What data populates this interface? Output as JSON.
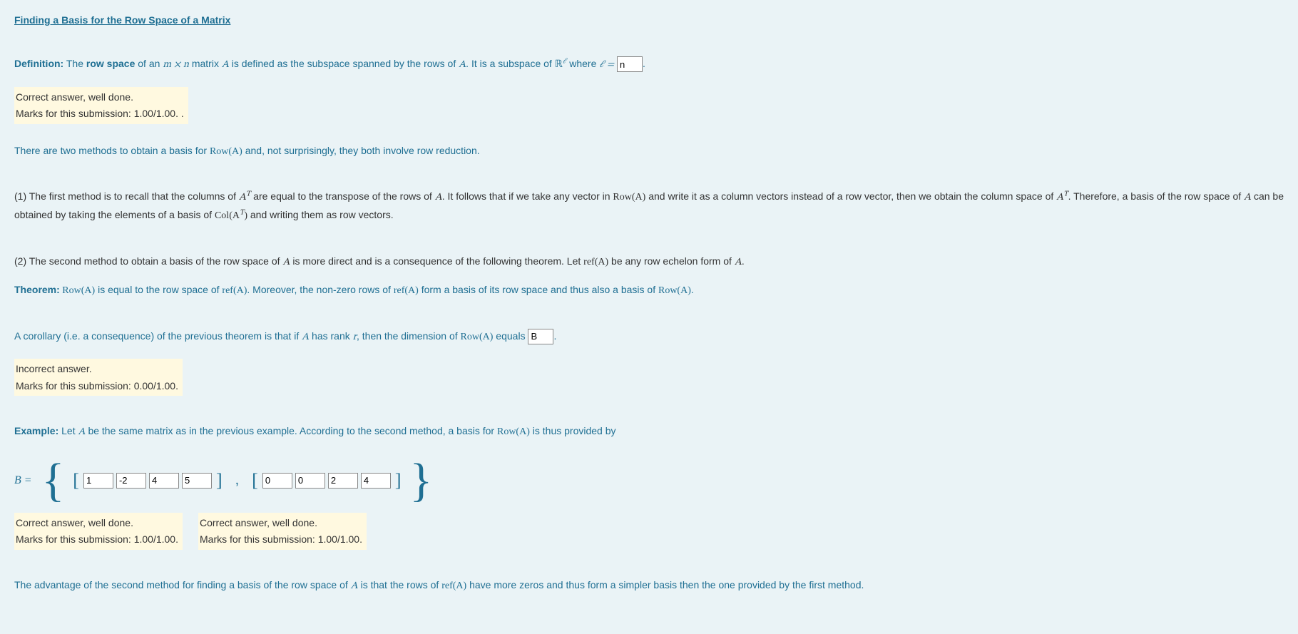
{
  "heading": "Finding a Basis for the Row Space of a Matrix",
  "definition": {
    "label": "Definition:",
    "pre": " The ",
    "term": "row space",
    "mid1": " of an ",
    "mxn": "m × n",
    "mid2": " matrix ",
    "A": "A",
    "mid3": " is defined as the subspace spanned by the rows of ",
    "A2": "A",
    "mid4": ". It is a subspace of ",
    "R": "ℝ",
    "ell": "ℓ",
    "where": " where ",
    "eq": "ℓ =",
    "input_value": "n",
    "period": "."
  },
  "feedback1": {
    "line1": "Correct answer, well done.",
    "line2": "Marks for this submission: 1.00/1.00. ."
  },
  "intro2": {
    "pre": "There are two methods to obtain a basis for ",
    "rowA": "Row(A)",
    "post": " and, not surprisingly, they both involve row reduction."
  },
  "method1": {
    "pre": "(1) The first method is to recall that the columns of ",
    "AT": "A",
    "Tsup": "T",
    "mid1": " are equal to the transpose of the rows of ",
    "A": "A",
    "mid2": ". It follows that if we take any vector in ",
    "rowA": "Row(A)",
    "mid3": " and write it as a column vectors instead of a row vector, then we obtain the column space of ",
    "AT2": "A",
    "Tsup2": "T",
    "mid4": ". Therefore, a basis of the row space of ",
    "A2": "A",
    "mid5": " can be obtained by taking the elements of a basis of ",
    "colAT": "Col(A",
    "Tsup3": "T",
    "colAT_close": ")",
    "post": " and writing them as row vectors."
  },
  "method2": {
    "pre": "(2) The second method to obtain a basis of the row space of ",
    "A": "A",
    "mid1": " is more direct and is  a consequence of the following theorem. Let ",
    "refA": "ref(A)",
    "mid2": " be any row echelon form of ",
    "A2": "A",
    "post": "."
  },
  "theorem": {
    "label": "Theorem:",
    "rowA": " Row(A)",
    "mid1": " is equal to the row space of ",
    "refA": "ref(A)",
    "mid2": ". Moreover, the non-zero rows of ",
    "refA2": "ref(A)",
    "mid3": " form a basis of its row space and thus also a basis of ",
    "rowA2": "Row(A)",
    "post": "."
  },
  "corollary": {
    "pre": "A corollary (i.e. a consequence) of the previous theorem is that if ",
    "A": "A",
    "mid1": " has rank ",
    "r": "r",
    "mid2": ", then the dimension of ",
    "rowA": "Row(A)",
    "equals": " equals ",
    "input_value": "B",
    "post": "."
  },
  "feedback2": {
    "line1": "Incorrect answer.",
    "line2": "Marks for this submission: 0.00/1.00."
  },
  "example": {
    "label": "Example:",
    "pre": " Let ",
    "A": "A",
    "mid1": " be the same matrix as in the previous example. According to the second method, a basis for ",
    "rowA": "Row(A)",
    "post": " is thus provided by"
  },
  "basis": {
    "B_eq": "B =",
    "vec1": [
      "1",
      "-2",
      "4",
      "5"
    ],
    "vec2": [
      "0",
      "0",
      "2",
      "4"
    ]
  },
  "feedback3a": {
    "line1": "Correct answer, well done.",
    "line2": "Marks for this submission: 1.00/1.00."
  },
  "feedback3b": {
    "line1": "Correct answer, well done.",
    "line2": "Marks for this submission: 1.00/1.00."
  },
  "advantage": {
    "pre": "The advantage of the second method for finding a basis of the row space of ",
    "A": "A",
    "mid1": " is that the rows of ",
    "refA": "ref(A)",
    "post": " have more zeros and thus form a simpler basis then the one provided by the first method."
  }
}
